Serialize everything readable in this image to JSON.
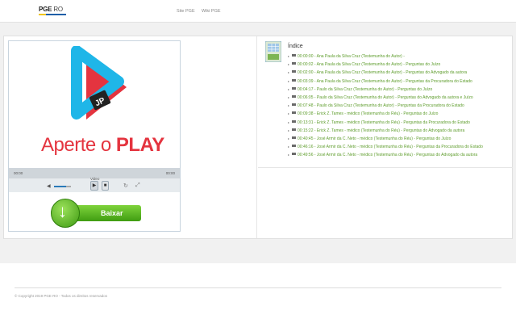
{
  "header": {
    "logo_main": "PGE",
    "logo_sub": "RO",
    "nav": [
      "Site PGE",
      "Wiki PGE"
    ]
  },
  "player": {
    "poster_text_1": "Aperte o ",
    "poster_text_2": "PLAY",
    "poster_badge": "JP",
    "time_start": "00:00",
    "time_end": "00:00",
    "video_label": "Video",
    "play_icon": "play-icon",
    "stop_icon": "stop-icon"
  },
  "download": {
    "label": "Baixar"
  },
  "index": {
    "title": "Índice",
    "items": [
      "00:00:00 - Ana Paula da Silva Cruz (Testemunha do Autor) -",
      "00:00:02 - Ana Paula da Silva Cruz (Testemunha do Autor) - Perguntas do Juízo",
      "00:02:00 - Ana Paula da Silva Cruz (Testemunha do Autor) - Perguntas do Advogado da autora",
      "00:03:39 - Ana Paula da Silva Cruz (Testemunha do Autor) - Perguntas da Procuradora do Estado",
      "00:04:17 - Paulo da Silva Cruz (Testemunha do Autor) - Perguntas do Juízo",
      "00:06:05 - Paulo da Silva Cruz (Testemunha do Autor) - Perguntas do Advogado da autora e Juízo",
      "00:07:48 - Paulo da Silva Cruz (Testemunha do Autor) - Perguntas da Procuradora do Estado",
      "00:09:38 - Erick Z. Tames - médico (Testemunha do Réu) - Perguntas do Juízo",
      "00:13:31 - Erick Z. Tames - médico (Testemunha do Réu) - Perguntas da Procuradora do Estado",
      "00:15:22 - Erick Z. Tames - médico (Testemunha do Réu) - Perguntas do Advogado da autora",
      "00:40:45 - José Armir da C. Neto - médico (Testemunha do Réu) - Perguntas do Juízo",
      "00:46:16 - José Armir da C. Neto - médico (Testemunha do Réu) - Perguntas da Procuradora do Estado",
      "00:49:56 - José Armir da C. Neto - médico (Testemunha do Réu) - Perguntas do Advogado da autora"
    ]
  },
  "footer": {
    "copyright": "© Copyright 2019 PGE RO - Todos os direitos reservados"
  },
  "colors": {
    "accent_green": "#5d9c2b",
    "play_red": "#e4343f",
    "play_cyan": "#1fb6e8"
  }
}
